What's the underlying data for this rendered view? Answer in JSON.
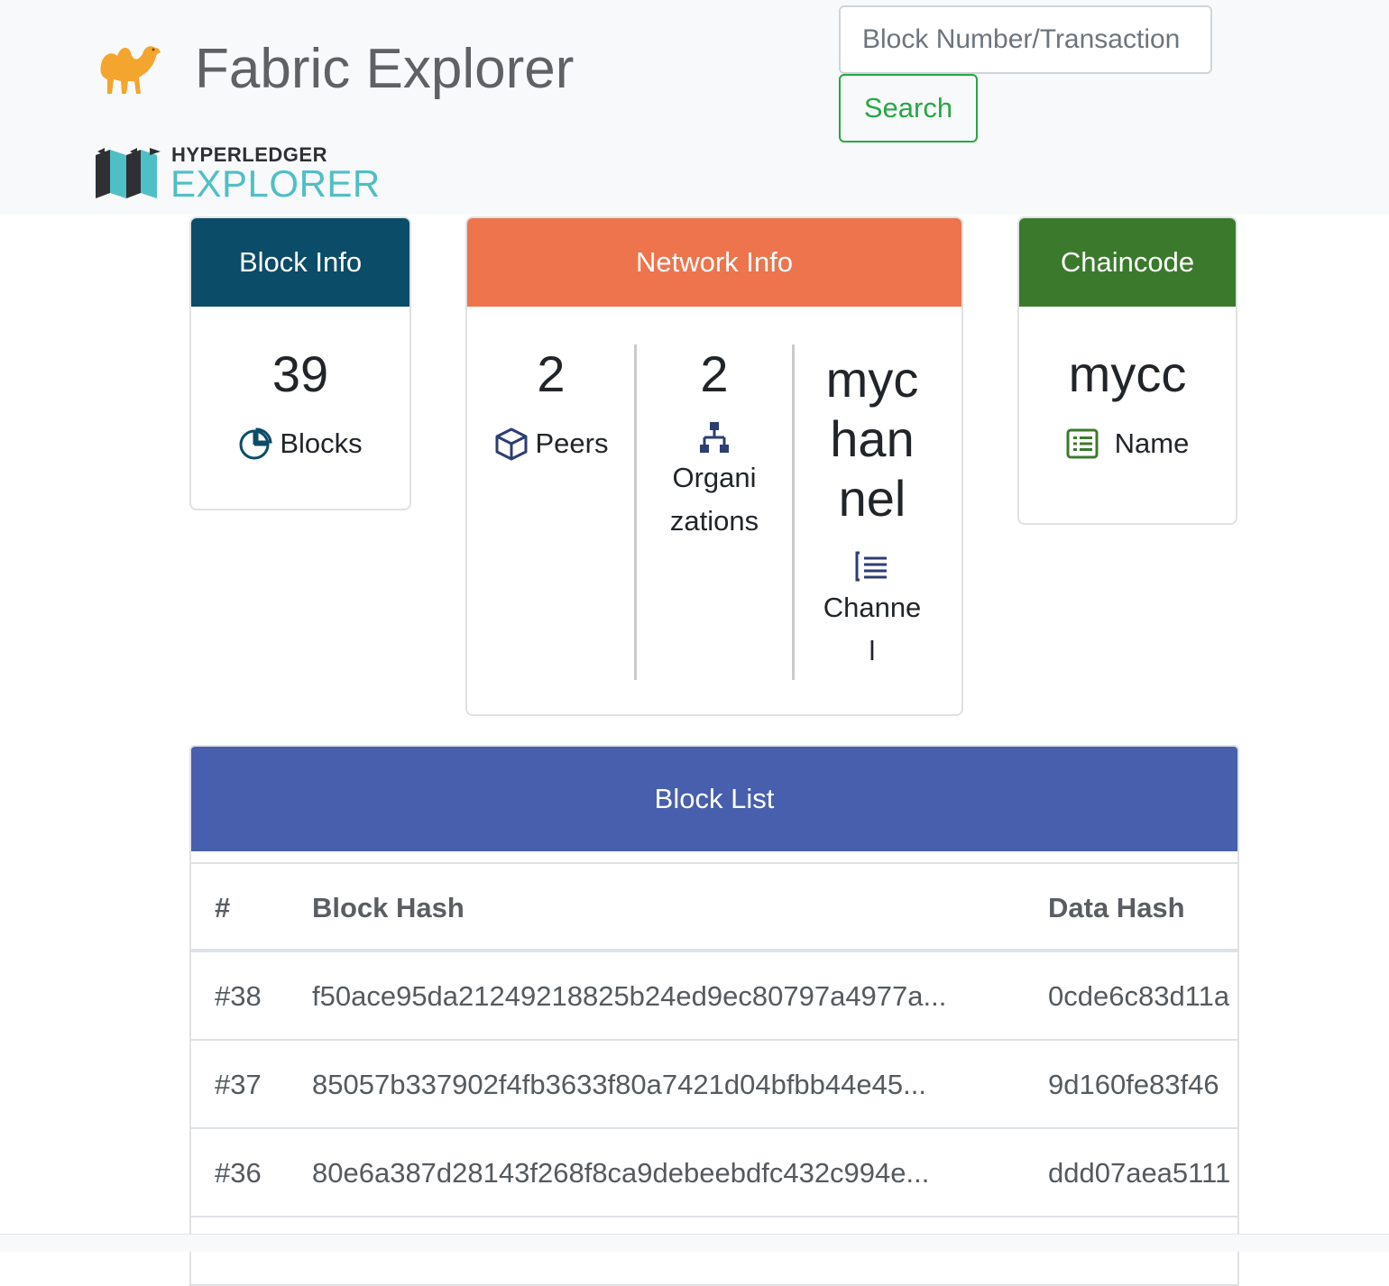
{
  "header": {
    "title": "Fabric Explorer",
    "logo_top": "HYPERLEDGER",
    "logo_bottom": "EXPLORER",
    "search_placeholder": "Block Number/Transaction",
    "search_button": "Search"
  },
  "block_info": {
    "title": "Block Info",
    "count": "39",
    "label": "Blocks"
  },
  "network_info": {
    "title": "Network Info",
    "peers": {
      "value": "2",
      "label": "Peers"
    },
    "orgs": {
      "value": "2",
      "label_line1": "Organi",
      "label_line2": "zations"
    },
    "channel": {
      "value_line1": "myc",
      "value_line2": "han",
      "value_line3": "nel",
      "label_line1": "Channe",
      "label_line2": "l"
    }
  },
  "chaincode": {
    "title": "Chaincode",
    "value": "mycc",
    "label": "Name"
  },
  "block_list": {
    "title": "Block List",
    "columns": [
      "#",
      "Block Hash",
      "Data Hash"
    ],
    "rows": [
      {
        "num": "#38",
        "block_hash": "f50ace95da21249218825b24ed9ec80797a4977a...",
        "data_hash": "0cde6c83d11a"
      },
      {
        "num": "#37",
        "block_hash": "85057b337902f4fb3633f80a7421d04bfbb44e45...",
        "data_hash": "9d160fe83f46"
      },
      {
        "num": "#36",
        "block_hash": "80e6a387d28143f268f8ca9debeebdfc432c994e...",
        "data_hash": "ddd07aea5111"
      }
    ]
  },
  "colors": {
    "block_info": "#0b4c68",
    "network_info": "#ed744c",
    "chaincode": "#3b7a2c",
    "block_list": "#475fad",
    "search_button": "#28a745",
    "logo_accent": "#4fbfc6"
  },
  "icons": {
    "camel": "camel-icon",
    "blocks": "pie-chart-icon",
    "peers": "cube-icon",
    "orgs": "sitemap-icon",
    "channel": "list-icon",
    "chaincode": "list-alt-icon"
  }
}
